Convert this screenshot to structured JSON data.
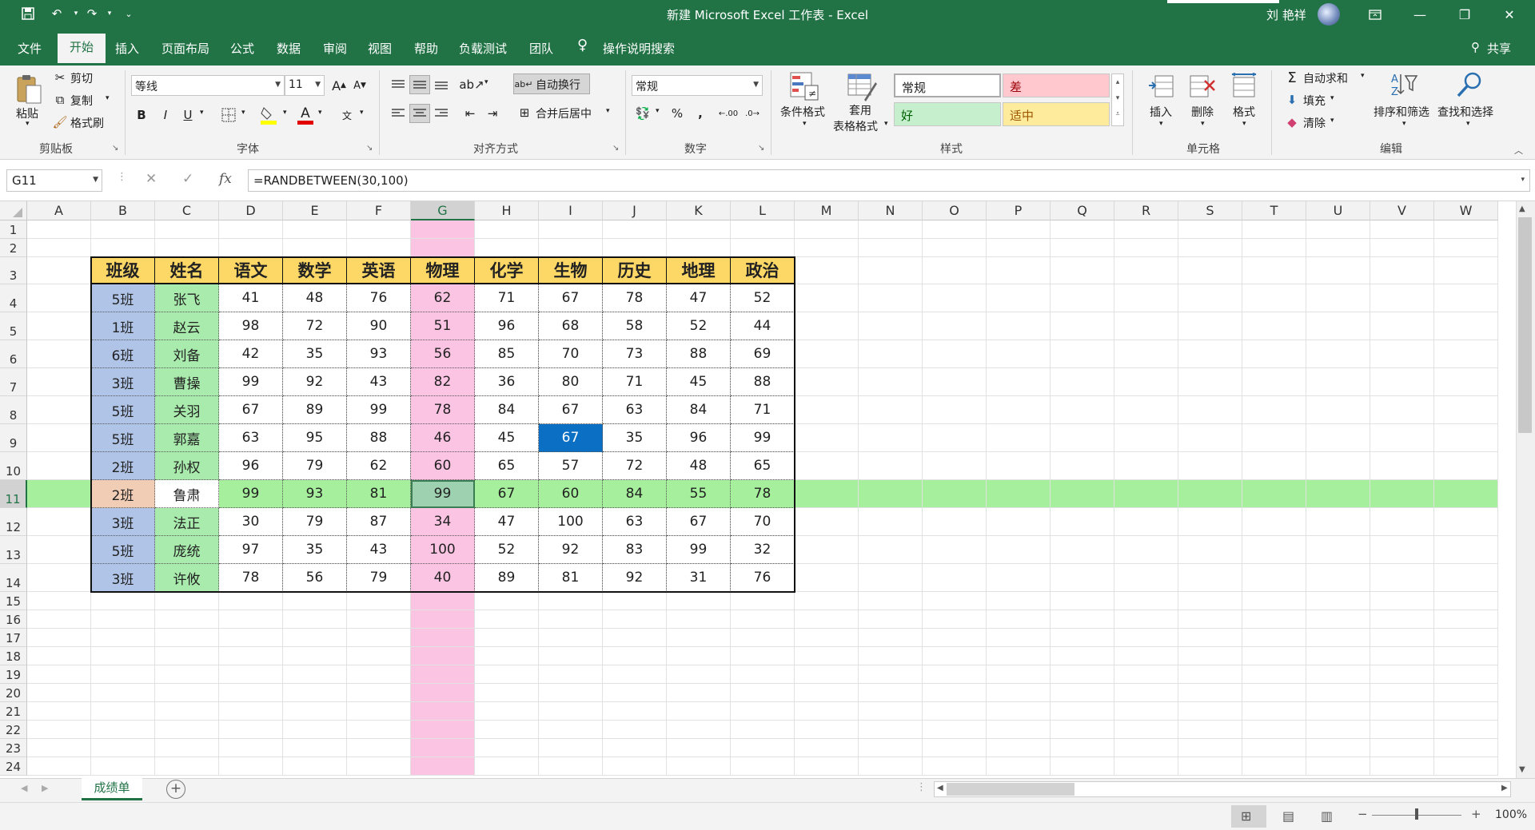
{
  "window": {
    "title": "新建 Microsoft Excel 工作表 - Excel",
    "user": "刘 艳祥",
    "qat": [
      "save-icon",
      "undo-icon",
      "redo-icon",
      "customize-icon"
    ]
  },
  "ribbon_tabs": [
    "文件",
    "开始",
    "插入",
    "页面布局",
    "公式",
    "数据",
    "审阅",
    "视图",
    "帮助",
    "负载测试",
    "团队"
  ],
  "active_tab": "开始",
  "tell_me": "操作说明搜索",
  "share": "共享",
  "clipboard": {
    "paste": "粘贴",
    "cut": "剪切",
    "copy": "复制",
    "format_painter": "格式刷",
    "label": "剪贴板"
  },
  "font": {
    "name": "等线",
    "size": "11",
    "bold": "B",
    "italic": "I",
    "underline": "U",
    "label": "字体",
    "grow": "A",
    "shrink": "A",
    "font_color_glyph": "A",
    "phonetic": "文"
  },
  "alignment": {
    "wrap": "自动换行",
    "merge": "合并后居中",
    "label": "对齐方式"
  },
  "number": {
    "format": "常规",
    "percent": "%",
    "comma": ",",
    "label": "数字",
    "inc_dec": ".00",
    "dec_dec": ".0"
  },
  "styles": {
    "conditional": "条件格式",
    "table_line1": "套用",
    "table_line2": "表格格式",
    "normal": "常规",
    "bad": "差",
    "good": "好",
    "neutral": "适中",
    "label": "样式"
  },
  "cells": {
    "insert": "插入",
    "delete": "删除",
    "format": "格式",
    "label": "单元格"
  },
  "editing": {
    "autosum": "自动求和",
    "fill": "填充",
    "clear": "清除",
    "sort": "排序和筛选",
    "find": "查找和选择",
    "label": "编辑"
  },
  "formula_bar": {
    "name_box": "G11",
    "formula": "=RANDBETWEEN(30,100)",
    "fx": "fx"
  },
  "columns": [
    "A",
    "B",
    "C",
    "D",
    "E",
    "F",
    "G",
    "H",
    "I",
    "J",
    "K",
    "L",
    "M",
    "N",
    "O",
    "P",
    "Q",
    "R",
    "S",
    "T",
    "U",
    "V",
    "W"
  ],
  "rows": [
    "1",
    "2",
    "3",
    "4",
    "5",
    "6",
    "7",
    "8",
    "9",
    "10",
    "11",
    "12",
    "13",
    "14",
    "15",
    "16",
    "17",
    "18",
    "19",
    "20",
    "21",
    "22",
    "23",
    "24"
  ],
  "selected_cell": "G11",
  "table": {
    "headers": [
      "班级",
      "姓名",
      "语文",
      "数学",
      "英语",
      "物理",
      "化学",
      "生物",
      "历史",
      "地理",
      "政治"
    ],
    "rows": [
      [
        "5班",
        "张飞",
        "41",
        "48",
        "76",
        "62",
        "71",
        "67",
        "78",
        "47",
        "52"
      ],
      [
        "1班",
        "赵云",
        "98",
        "72",
        "90",
        "51",
        "96",
        "68",
        "58",
        "52",
        "44"
      ],
      [
        "6班",
        "刘备",
        "42",
        "35",
        "93",
        "56",
        "85",
        "70",
        "73",
        "88",
        "69"
      ],
      [
        "3班",
        "曹操",
        "99",
        "92",
        "43",
        "82",
        "36",
        "80",
        "71",
        "45",
        "88"
      ],
      [
        "5班",
        "关羽",
        "67",
        "89",
        "99",
        "78",
        "84",
        "67",
        "63",
        "84",
        "71"
      ],
      [
        "5班",
        "郭嘉",
        "63",
        "95",
        "88",
        "46",
        "45",
        "67",
        "35",
        "96",
        "99"
      ],
      [
        "2班",
        "孙权",
        "96",
        "79",
        "62",
        "60",
        "65",
        "57",
        "72",
        "48",
        "65"
      ],
      [
        "2班",
        "鲁肃",
        "99",
        "93",
        "81",
        "99",
        "67",
        "60",
        "84",
        "55",
        "78"
      ],
      [
        "3班",
        "法正",
        "30",
        "79",
        "87",
        "34",
        "47",
        "100",
        "63",
        "67",
        "70"
      ],
      [
        "5班",
        "庞统",
        "97",
        "35",
        "43",
        "100",
        "52",
        "92",
        "83",
        "99",
        "32"
      ],
      [
        "3班",
        "许攸",
        "78",
        "56",
        "79",
        "40",
        "89",
        "81",
        "92",
        "31",
        "76"
      ]
    ]
  },
  "colors": {
    "excel_green": "#217346",
    "header_yellow": "#fdd866",
    "class_blue": "#b0c4e8",
    "name_green": "#a8ebac",
    "physics_pink": "#fbc4e2",
    "row_highlight": "#a6ef9c",
    "selected_blue": "#0b6fc4"
  },
  "sheet_tab": "成绩单",
  "zoom": "100%"
}
